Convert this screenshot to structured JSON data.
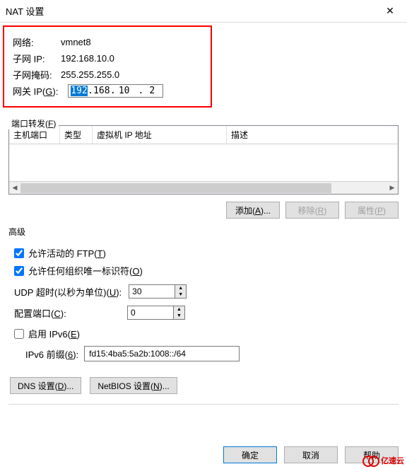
{
  "title": "NAT 设置",
  "network": {
    "label": "网络:",
    "value": "vmnet8"
  },
  "subnet_ip": {
    "label": "子网 IP:",
    "value": "192.168.10.0"
  },
  "subnet_mask": {
    "label": "子网掩码:",
    "value": "255.255.255.0"
  },
  "gateway": {
    "label": "网关 IP(G):",
    "oct1": "192",
    "oct2": "168",
    "oct3": "10",
    "oct4": "2"
  },
  "port_forward": {
    "label": "端口转发(F)",
    "columns": {
      "host_port": "主机端口",
      "type": "类型",
      "vm_ip": "虚拟机 IP 地址",
      "desc": "描述"
    },
    "add": "添加(A)...",
    "remove": "移除(R)",
    "props": "属性(P)"
  },
  "advanced": {
    "label": "高级",
    "ftp": "允许活动的 FTP(T)",
    "uid": "允许任何组织唯一标识符(O)",
    "udp_label": "UDP 超时(以秒为单位)(U):",
    "udp_value": "30",
    "config_port_label": "配置端口(C):",
    "config_port_value": "0",
    "ipv6_enable": "启用 IPv6(E)",
    "ipv6_prefix_label": "IPv6 前缀(6):",
    "ipv6_prefix_value": "fd15:4ba5:5a2b:1008::/64"
  },
  "dns_btn": "DNS 设置(D)...",
  "netbios_btn": "NetBIOS 设置(N)...",
  "ok": "确定",
  "cancel": "取消",
  "help": "帮助",
  "logo": "亿速云"
}
